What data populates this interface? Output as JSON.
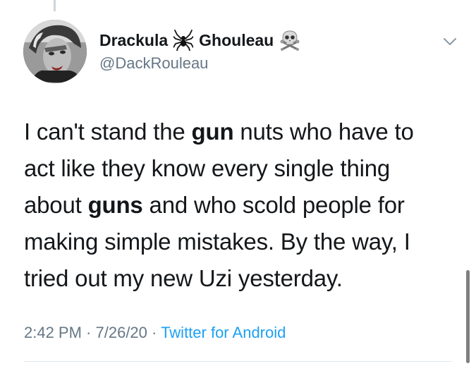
{
  "author": {
    "name_first": "Drackula",
    "name_last": "Ghouleau",
    "handle": "@DackRouleau"
  },
  "tweet": {
    "lines": [
      [
        "I can't stand the ",
        "gun",
        " nuts who have to"
      ],
      [
        "act like they know every single thing"
      ],
      [
        "about ",
        "guns",
        " and who scold people for"
      ],
      [
        "making simple mistakes. By the way, I"
      ],
      [
        "tried out my new Uzi yesterday."
      ]
    ]
  },
  "meta": {
    "time": "2:42 PM",
    "sep1": " · ",
    "date": "7/26/20",
    "sep2": " · ",
    "source": "Twitter for Android"
  },
  "icons": {
    "name_emoji_1": "spider-icon",
    "name_emoji_2": "skull-crossbones-icon",
    "menu": "chevron-down-icon"
  },
  "colors": {
    "secondary_text": "#657786",
    "link": "#1da1f2",
    "divider": "#e1e8ed"
  }
}
